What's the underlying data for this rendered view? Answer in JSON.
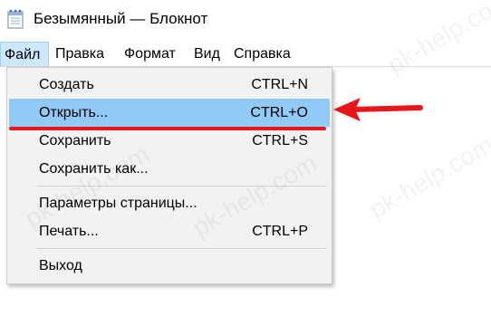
{
  "window": {
    "title": "Безымянный — Блокнот"
  },
  "menubar": {
    "items": [
      {
        "label": "Файл",
        "active": true
      },
      {
        "label": "Правка"
      },
      {
        "label": "Формат"
      },
      {
        "label": "Вид"
      },
      {
        "label": "Справка"
      }
    ]
  },
  "file_menu": {
    "items": [
      {
        "label": "Создать",
        "shortcut": "CTRL+N"
      },
      {
        "label": "Открыть...",
        "shortcut": "CTRL+O",
        "highlighted": true
      },
      {
        "label": "Сохранить",
        "shortcut": "CTRL+S"
      },
      {
        "label": "Сохранить как...",
        "shortcut": ""
      },
      {
        "label": "Параметры страницы...",
        "shortcut": ""
      },
      {
        "label": "Печать...",
        "shortcut": "CTRL+P"
      },
      {
        "label": "Выход",
        "shortcut": ""
      }
    ]
  },
  "watermark": {
    "text": "pk-help.com"
  },
  "colors": {
    "menu_highlight": "#91c9f7",
    "menubar_active": "#cce8ff",
    "annotation": "#e8151b"
  },
  "icons": {
    "app": "notepad-icon",
    "annotation_arrow": "red-arrow-icon"
  }
}
